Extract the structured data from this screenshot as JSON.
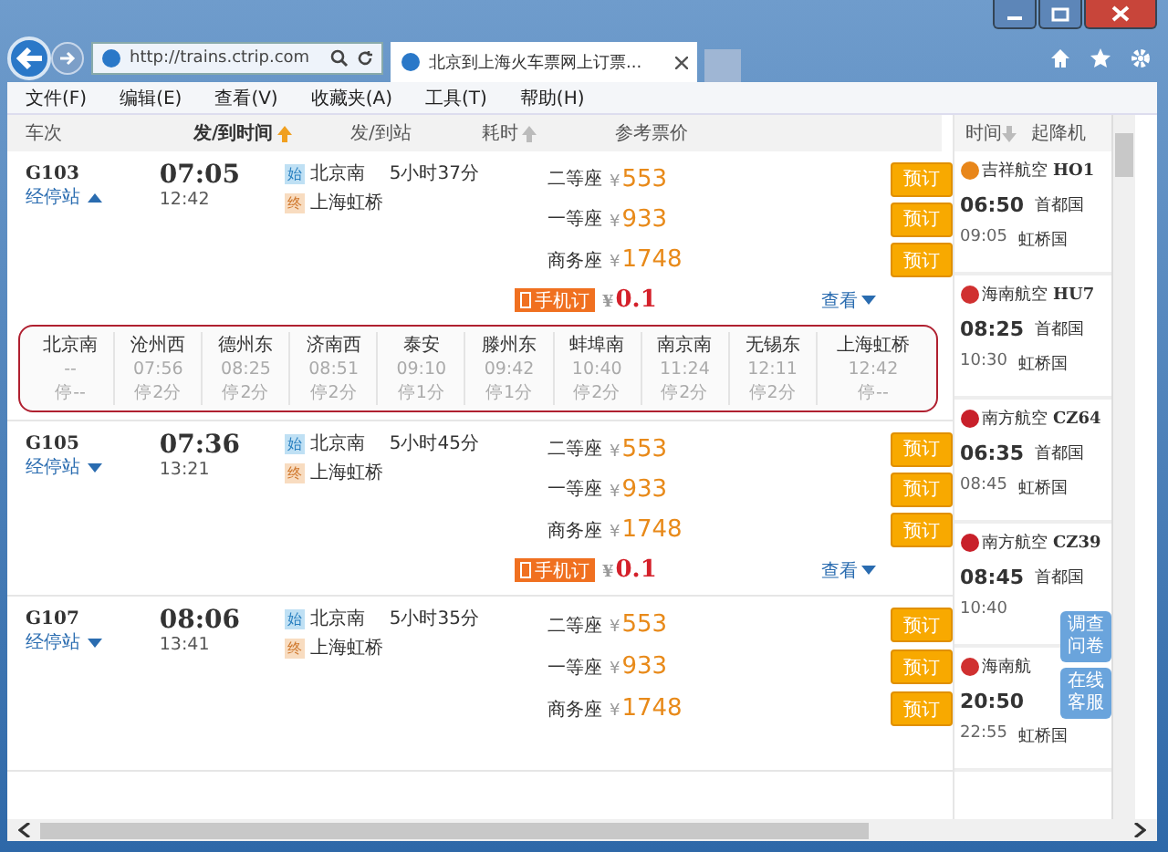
{
  "browser": {
    "address": "http://trains.ctrip.com",
    "tab_title": "北京到上海火车票网上订票..."
  },
  "menu": [
    "文件(F)",
    "编辑(E)",
    "查看(V)",
    "收藏夹(A)",
    "工具(T)",
    "帮助(H)"
  ],
  "columns": [
    {
      "label": "车次",
      "sortable": false,
      "active": false
    },
    {
      "label": "发/到时间",
      "sortable": true,
      "active": true
    },
    {
      "label": "发/到站",
      "sortable": false,
      "active": false
    },
    {
      "label": "耗时",
      "sortable": true,
      "active": false
    },
    {
      "label": "参考票价",
      "sortable": false,
      "active": false
    }
  ],
  "trains": [
    {
      "number": "G103",
      "stops_label": "经停站",
      "expanded": true,
      "depart": "07:05",
      "arrive": "12:42",
      "from_badge": "始",
      "from": "北京南",
      "to_badge": "终",
      "to": "上海虹桥",
      "duration": "5小时37分",
      "fares": [
        {
          "seat": "二等座",
          "currency": "¥",
          "price": "553",
          "button": "预订"
        },
        {
          "seat": "一等座",
          "currency": "¥",
          "price": "933",
          "button": "预订"
        },
        {
          "seat": "商务座",
          "currency": "¥",
          "price": "1748",
          "button": "预订"
        }
      ],
      "mobile": {
        "badge": "手机订",
        "currency": "¥",
        "price": "0.1",
        "link": "查看"
      },
      "stops": [
        {
          "name": "北京南",
          "time": "--",
          "stay": "停--"
        },
        {
          "name": "沧州西",
          "time": "07:56",
          "stay": "停2分"
        },
        {
          "name": "德州东",
          "time": "08:25",
          "stay": "停2分"
        },
        {
          "name": "济南西",
          "time": "08:51",
          "stay": "停2分"
        },
        {
          "name": "泰安",
          "time": "09:10",
          "stay": "停1分"
        },
        {
          "name": "滕州东",
          "time": "09:42",
          "stay": "停1分"
        },
        {
          "name": "蚌埠南",
          "time": "10:40",
          "stay": "停2分"
        },
        {
          "name": "南京南",
          "time": "11:24",
          "stay": "停2分"
        },
        {
          "name": "无锡东",
          "time": "12:11",
          "stay": "停2分"
        },
        {
          "name": "上海虹桥",
          "time": "12:42",
          "stay": "停--"
        }
      ]
    },
    {
      "number": "G105",
      "stops_label": "经停站",
      "expanded": false,
      "depart": "07:36",
      "arrive": "13:21",
      "from_badge": "始",
      "from": "北京南",
      "to_badge": "终",
      "to": "上海虹桥",
      "duration": "5小时45分",
      "fares": [
        {
          "seat": "二等座",
          "currency": "¥",
          "price": "553",
          "button": "预订"
        },
        {
          "seat": "一等座",
          "currency": "¥",
          "price": "933",
          "button": "预订"
        },
        {
          "seat": "商务座",
          "currency": "¥",
          "price": "1748",
          "button": "预订"
        }
      ],
      "mobile": {
        "badge": "手机订",
        "currency": "¥",
        "price": "0.1",
        "link": "查看"
      }
    },
    {
      "number": "G107",
      "stops_label": "经停站",
      "expanded": false,
      "depart": "08:06",
      "arrive": "13:41",
      "from_badge": "始",
      "from": "北京南",
      "to_badge": "终",
      "to": "上海虹桥",
      "duration": "5小时35分",
      "fares": [
        {
          "seat": "二等座",
          "currency": "¥",
          "price": "553",
          "button": "预订"
        },
        {
          "seat": "一等座",
          "currency": "¥",
          "price": "933",
          "button": "预订"
        },
        {
          "seat": "商务座",
          "currency": "¥",
          "price": "1748",
          "button": "预订"
        }
      ]
    }
  ],
  "sidebar": {
    "columns": [
      {
        "label": "时间",
        "sortable": true
      },
      {
        "label": "起降机",
        "sortable": false
      }
    ],
    "flights": [
      {
        "airline": "吉祥航空",
        "code": "HO1",
        "color": "#e8861a",
        "depart": "06:50",
        "depart_airport": "首都国",
        "arrive": "09:05",
        "arrive_airport": "虹桥国"
      },
      {
        "airline": "海南航空",
        "code": "HU7",
        "color": "#d03030",
        "depart": "08:25",
        "depart_airport": "首都国",
        "arrive": "10:30",
        "arrive_airport": "虹桥国"
      },
      {
        "airline": "南方航空",
        "code": "CZ64",
        "color": "#c8202a",
        "depart": "06:35",
        "depart_airport": "首都国",
        "arrive": "08:45",
        "arrive_airport": "虹桥国"
      },
      {
        "airline": "南方航空",
        "code": "CZ39",
        "color": "#c8202a",
        "depart": "08:45",
        "depart_airport": "首都国",
        "arrive": "10:40"
      },
      {
        "airline": "海南航",
        "color": "#d03030",
        "depart": "20:50",
        "arrive": "22:55",
        "arrive_airport": "虹桥国"
      }
    ]
  },
  "float_buttons": [
    "调查问卷",
    "在线客服"
  ]
}
